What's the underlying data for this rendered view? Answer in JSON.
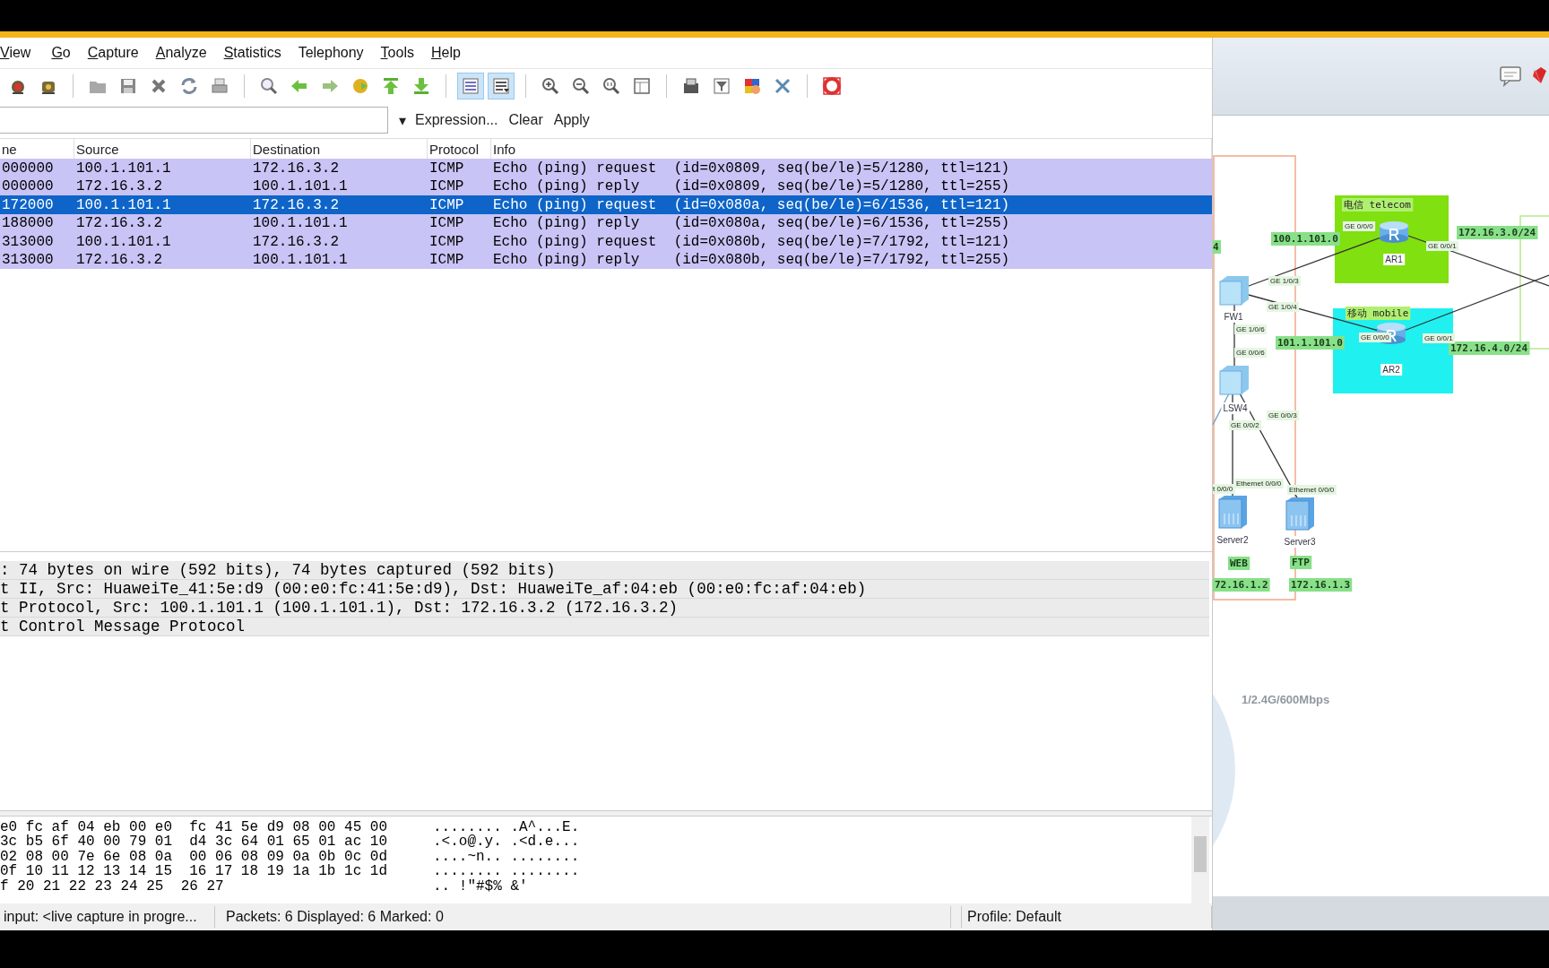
{
  "menu": [
    "View",
    "Go",
    "Capture",
    "Analyze",
    "Statistics",
    "Telephony",
    "Tools",
    "Help"
  ],
  "toolbar_groups": [
    [
      {
        "kind": "capture",
        "pressed": false
      },
      {
        "kind": "capture-options",
        "pressed": false
      }
    ],
    [
      {
        "kind": "open",
        "pressed": false
      },
      {
        "kind": "save",
        "pressed": false
      },
      {
        "kind": "close",
        "pressed": false
      },
      {
        "kind": "reload",
        "pressed": false
      },
      {
        "kind": "print",
        "pressed": false
      }
    ],
    [
      {
        "kind": "find",
        "pressed": false
      },
      {
        "kind": "back",
        "pressed": false
      },
      {
        "kind": "forward",
        "pressed": false
      },
      {
        "kind": "goto",
        "pressed": false
      },
      {
        "kind": "first",
        "pressed": false
      },
      {
        "kind": "last",
        "pressed": false
      }
    ],
    [
      {
        "kind": "colorize",
        "pressed": true
      },
      {
        "kind": "autoscroll",
        "pressed": true
      }
    ],
    [
      {
        "kind": "zoom-in",
        "pressed": false
      },
      {
        "kind": "zoom-out",
        "pressed": false
      },
      {
        "kind": "zoom-reset",
        "pressed": false
      },
      {
        "kind": "resize",
        "pressed": false
      }
    ],
    [
      {
        "kind": "capture-filter",
        "pressed": false
      },
      {
        "kind": "display-filter",
        "pressed": false
      },
      {
        "kind": "coloring",
        "pressed": false
      },
      {
        "kind": "preferences",
        "pressed": false
      }
    ],
    [
      {
        "kind": "help",
        "pressed": false
      }
    ]
  ],
  "filter": {
    "caret": "▾",
    "buttons": [
      "Expression...",
      "Clear",
      "Apply"
    ]
  },
  "packet_list": {
    "columns": [
      "ne",
      "Source",
      "Destination",
      "Protocol",
      "Info"
    ],
    "rows": [
      {
        "cells": [
          "000000",
          "100.1.101.1",
          "172.16.3.2",
          "ICMP",
          "Echo (ping) request  (id=0x0809, seq(be/le)=5/1280, ttl=121)"
        ],
        "selected": false
      },
      {
        "cells": [
          "000000",
          "172.16.3.2",
          "100.1.101.1",
          "ICMP",
          "Echo (ping) reply    (id=0x0809, seq(be/le)=5/1280, ttl=255)"
        ],
        "selected": false
      },
      {
        "cells": [
          "172000",
          "100.1.101.1",
          "172.16.3.2",
          "ICMP",
          "Echo (ping) request  (id=0x080a, seq(be/le)=6/1536, ttl=121)"
        ],
        "selected": true
      },
      {
        "cells": [
          "188000",
          "172.16.3.2",
          "100.1.101.1",
          "ICMP",
          "Echo (ping) reply    (id=0x080a, seq(be/le)=6/1536, ttl=255)"
        ],
        "selected": false
      },
      {
        "cells": [
          "313000",
          "100.1.101.1",
          "172.16.3.2",
          "ICMP",
          "Echo (ping) request  (id=0x080b, seq(be/le)=7/1792, ttl=121)"
        ],
        "selected": false
      },
      {
        "cells": [
          "313000",
          "172.16.3.2",
          "100.1.101.1",
          "ICMP",
          "Echo (ping) reply    (id=0x080b, seq(be/le)=7/1792, ttl=255)"
        ],
        "selected": false
      }
    ]
  },
  "details": [
    ": 74 bytes on wire (592 bits), 74 bytes captured (592 bits)",
    "t II, Src: HuaweiTe_41:5e:d9 (00:e0:fc:41:5e:d9), Dst: HuaweiTe_af:04:eb (00:e0:fc:af:04:eb)",
    "t Protocol, Src: 100.1.101.1 (100.1.101.1), Dst: 172.16.3.2 (172.16.3.2)",
    "t Control Message Protocol"
  ],
  "hex_rows": [
    {
      "bytes": "e0 fc af 04 eb 00 e0  fc 41 5e d9 08 00 45 00",
      "ascii": "........ .A^...E."
    },
    {
      "bytes": "3c b5 6f 40 00 79 01  d4 3c 64 01 65 01 ac 10",
      "ascii": ".<.o@.y. .<d.e..."
    },
    {
      "bytes": "02 08 00 7e 6e 08 0a  00 06 08 09 0a 0b 0c 0d",
      "ascii": "....~n.. ........"
    },
    {
      "bytes": "0f 10 11 12 13 14 15  16 17 18 19 1a 1b 1c 1d",
      "ascii": "........ ........"
    },
    {
      "bytes": "f 20 21 22 23 24 25  26 27",
      "ascii": ".. !\"#$% &'"
    }
  ],
  "status_bar": [
    "input: <live capture in progre...",
    "Packets: 6 Displayed: 6 Marked: 0",
    "Profile: Default"
  ],
  "diagram": {
    "areas": [
      {
        "label": "电信 telecom",
        "color": "#80e010"
      },
      {
        "label": "移动 mobile",
        "color": "#20f0f0"
      }
    ],
    "nodes": [
      {
        "kind": "firewall",
        "label": "FW1"
      },
      {
        "kind": "router",
        "label": "AR1"
      },
      {
        "kind": "router",
        "label": "AR2"
      },
      {
        "kind": "switch",
        "label": "LSW4"
      },
      {
        "kind": "server",
        "label": "Server2"
      },
      {
        "kind": "server",
        "label": "Server3"
      }
    ],
    "subnet_labels": [
      "4",
      "100.1.101.0",
      "172.16.3.0/24",
      "101.1.101.0",
      "172.16.4.0/24",
      "WEB",
      "FTP",
      "72.16.1.2",
      "172.16.1.3"
    ],
    "port_labels": [
      "GE 0/0/0",
      "GE 0/0/1",
      "GE 1/0/3",
      "GE 1/0/4",
      "GE 0/0/0",
      "GE 0/0/1",
      "GE 1/0/6",
      "GE 0/0/6",
      "GE 0/0/2",
      "GE 0/0/3",
      "t 0/0/0",
      "Ethernet 0/0/0",
      "Ethernet 0/0/0"
    ],
    "caption": "1/2.4G/600Mbps"
  }
}
